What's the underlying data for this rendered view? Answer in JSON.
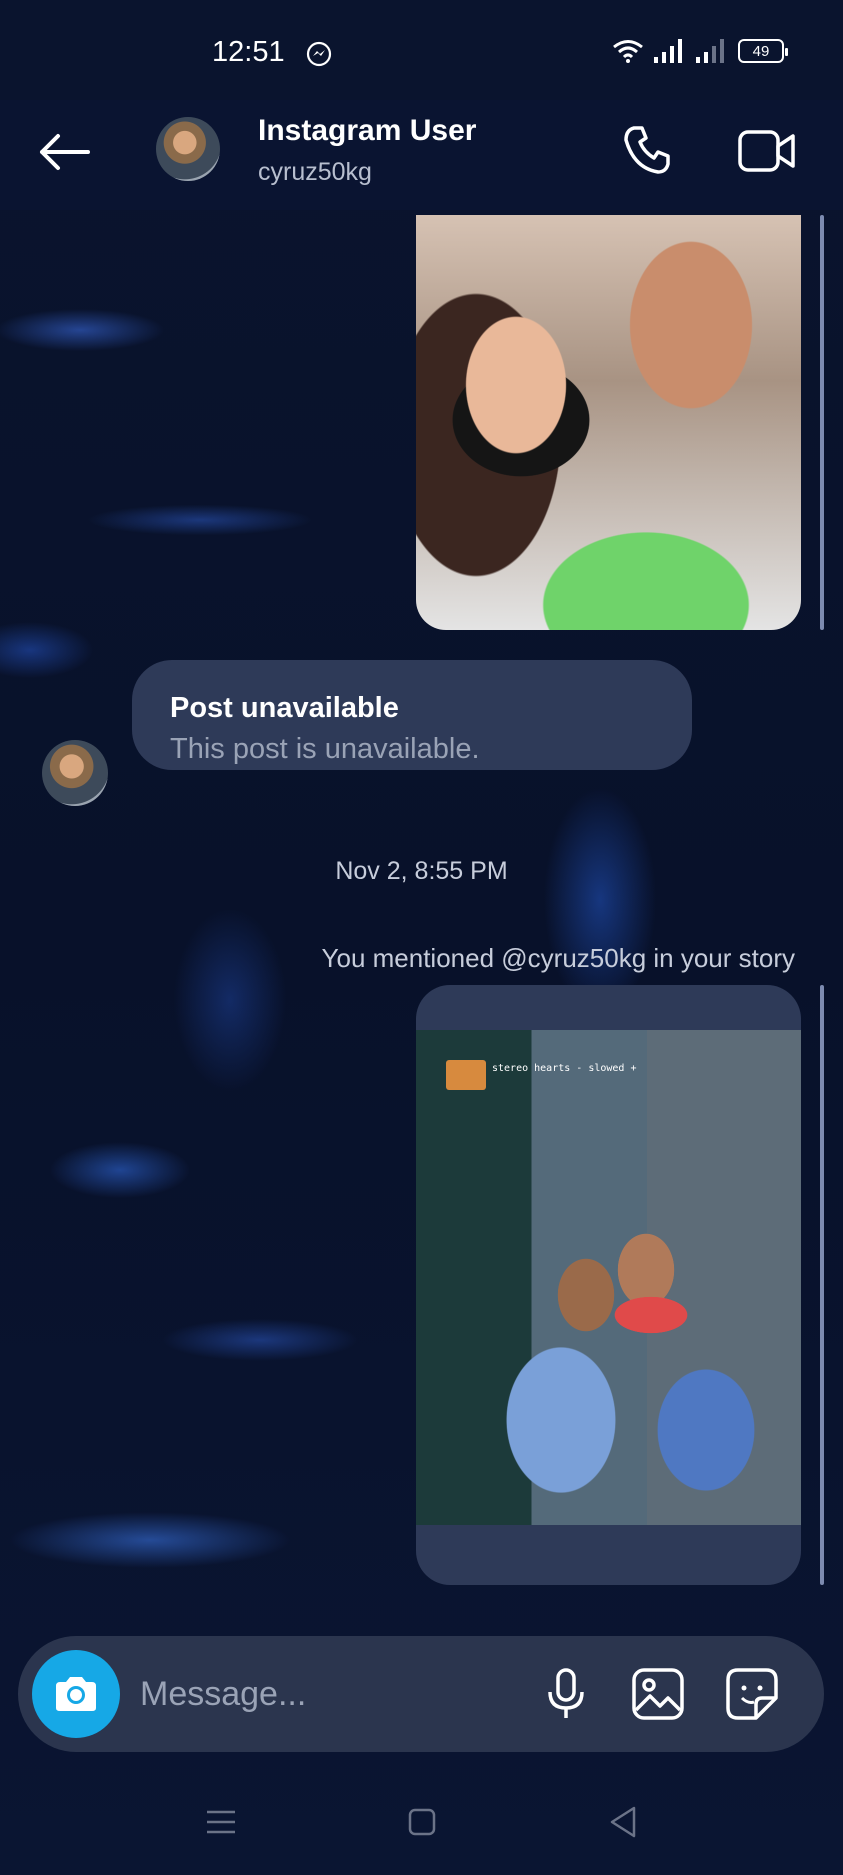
{
  "status_bar": {
    "time": "12:51",
    "battery": "49",
    "icons": [
      "messenger-icon",
      "wifi-icon",
      "signal-icon",
      "signal-icon-2",
      "battery-icon"
    ]
  },
  "header": {
    "name": "Instagram User",
    "username": "cyruz50kg",
    "icons": [
      "back-arrow-icon",
      "phone-icon",
      "video-camera-icon"
    ]
  },
  "messages": {
    "post_title": "Post unavailable",
    "post_subtitle": "This post is unavailable.",
    "timestamp": "Nov 2, 8:55 PM",
    "mention": "You mentioned @cyruz50kg in your story",
    "story_music": "stereo hearts - slowed +"
  },
  "composer": {
    "placeholder": "Message...",
    "icons": [
      "camera-icon",
      "microphone-icon",
      "gallery-icon",
      "sticker-icon"
    ]
  },
  "nav": {
    "icons": [
      "menu-icon",
      "home-icon",
      "back-icon"
    ]
  },
  "colors": {
    "background": "#0b1530",
    "bubble": "#2e3a58",
    "composer": "#2b354e",
    "camera_button": "#16a8e6"
  }
}
